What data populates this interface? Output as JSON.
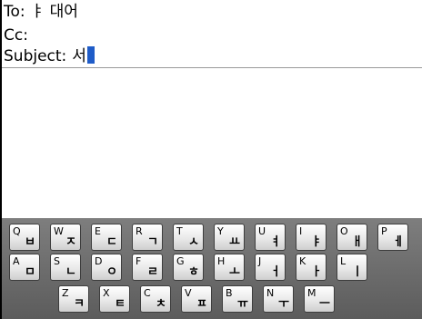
{
  "compose": {
    "to_label": "To:",
    "to_value": "ㅑ 대어",
    "cc_label": "Cc:",
    "cc_value": "",
    "subject_label": "Subject:",
    "subject_value": "서"
  },
  "keyboard": {
    "rows": [
      [
        {
          "latin": "Q",
          "hangul": "ㅂ"
        },
        {
          "latin": "W",
          "hangul": "ㅈ"
        },
        {
          "latin": "E",
          "hangul": "ㄷ"
        },
        {
          "latin": "R",
          "hangul": "ㄱ"
        },
        {
          "latin": "T",
          "hangul": "ㅅ"
        },
        {
          "latin": "Y",
          "hangul": "ㅛ"
        },
        {
          "latin": "U",
          "hangul": "ㅕ"
        },
        {
          "latin": "I",
          "hangul": "ㅑ"
        },
        {
          "latin": "O",
          "hangul": "ㅐ"
        },
        {
          "latin": "P",
          "hangul": "ㅔ"
        }
      ],
      [
        {
          "latin": "A",
          "hangul": "ㅁ"
        },
        {
          "latin": "S",
          "hangul": "ㄴ"
        },
        {
          "latin": "D",
          "hangul": "ㅇ"
        },
        {
          "latin": "F",
          "hangul": "ㄹ"
        },
        {
          "latin": "G",
          "hangul": "ㅎ"
        },
        {
          "latin": "H",
          "hangul": "ㅗ"
        },
        {
          "latin": "J",
          "hangul": "ㅓ"
        },
        {
          "latin": "K",
          "hangul": "ㅏ"
        },
        {
          "latin": "L",
          "hangul": "ㅣ"
        }
      ],
      [
        {
          "latin": "Z",
          "hangul": "ㅋ"
        },
        {
          "latin": "X",
          "hangul": "ㅌ"
        },
        {
          "latin": "C",
          "hangul": "ㅊ"
        },
        {
          "latin": "V",
          "hangul": "ㅍ"
        },
        {
          "latin": "B",
          "hangul": "ㅠ"
        },
        {
          "latin": "N",
          "hangul": "ㅜ"
        },
        {
          "latin": "M",
          "hangul": "ㅡ"
        }
      ]
    ]
  }
}
